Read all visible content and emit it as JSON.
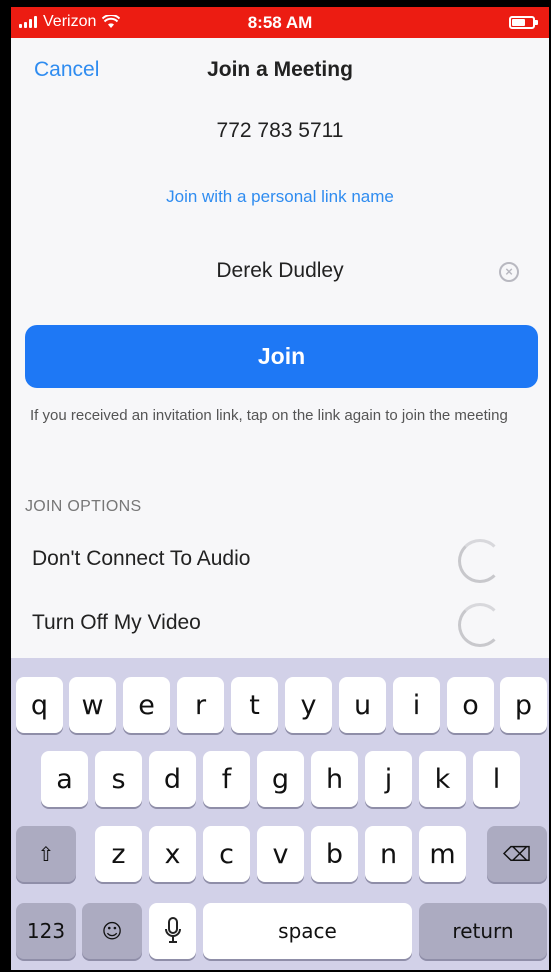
{
  "status_bar": {
    "carrier": "Verizon",
    "time": "8:58 AM",
    "wifi_icon": "wifi-icon",
    "battery_icon": "battery-icon"
  },
  "header": {
    "cancel": "Cancel",
    "title": "Join a Meeting"
  },
  "meeting_id": "772 783 5711",
  "personal_link": "Join with a personal link name",
  "name_field": {
    "value": "Derek Dudley",
    "clear_icon": "×"
  },
  "join_button": "Join",
  "hint": "If you received an invitation link, tap on the link again to join the meeting",
  "join_options": {
    "title": "JOIN OPTIONS",
    "items": [
      {
        "label": "Don't Connect To Audio",
        "on": false
      },
      {
        "label": "Turn Off My Video",
        "on": false
      }
    ]
  },
  "keyboard": {
    "row1": [
      "q",
      "w",
      "e",
      "r",
      "t",
      "y",
      "u",
      "i",
      "o",
      "p"
    ],
    "row2": [
      "a",
      "s",
      "d",
      "f",
      "g",
      "h",
      "j",
      "k",
      "l"
    ],
    "row3": [
      "z",
      "x",
      "c",
      "v",
      "b",
      "n",
      "m"
    ],
    "shift": "⇧",
    "backspace": "⌫",
    "numbers": "123",
    "emoji": "☺",
    "mic": "🎤",
    "space": "space",
    "return": "return"
  },
  "colors": {
    "status_bar": "#ec1c12",
    "accent": "#2f8cf0",
    "join_button": "#1e78f5",
    "keyboard_bg": "#d2d1e8"
  }
}
